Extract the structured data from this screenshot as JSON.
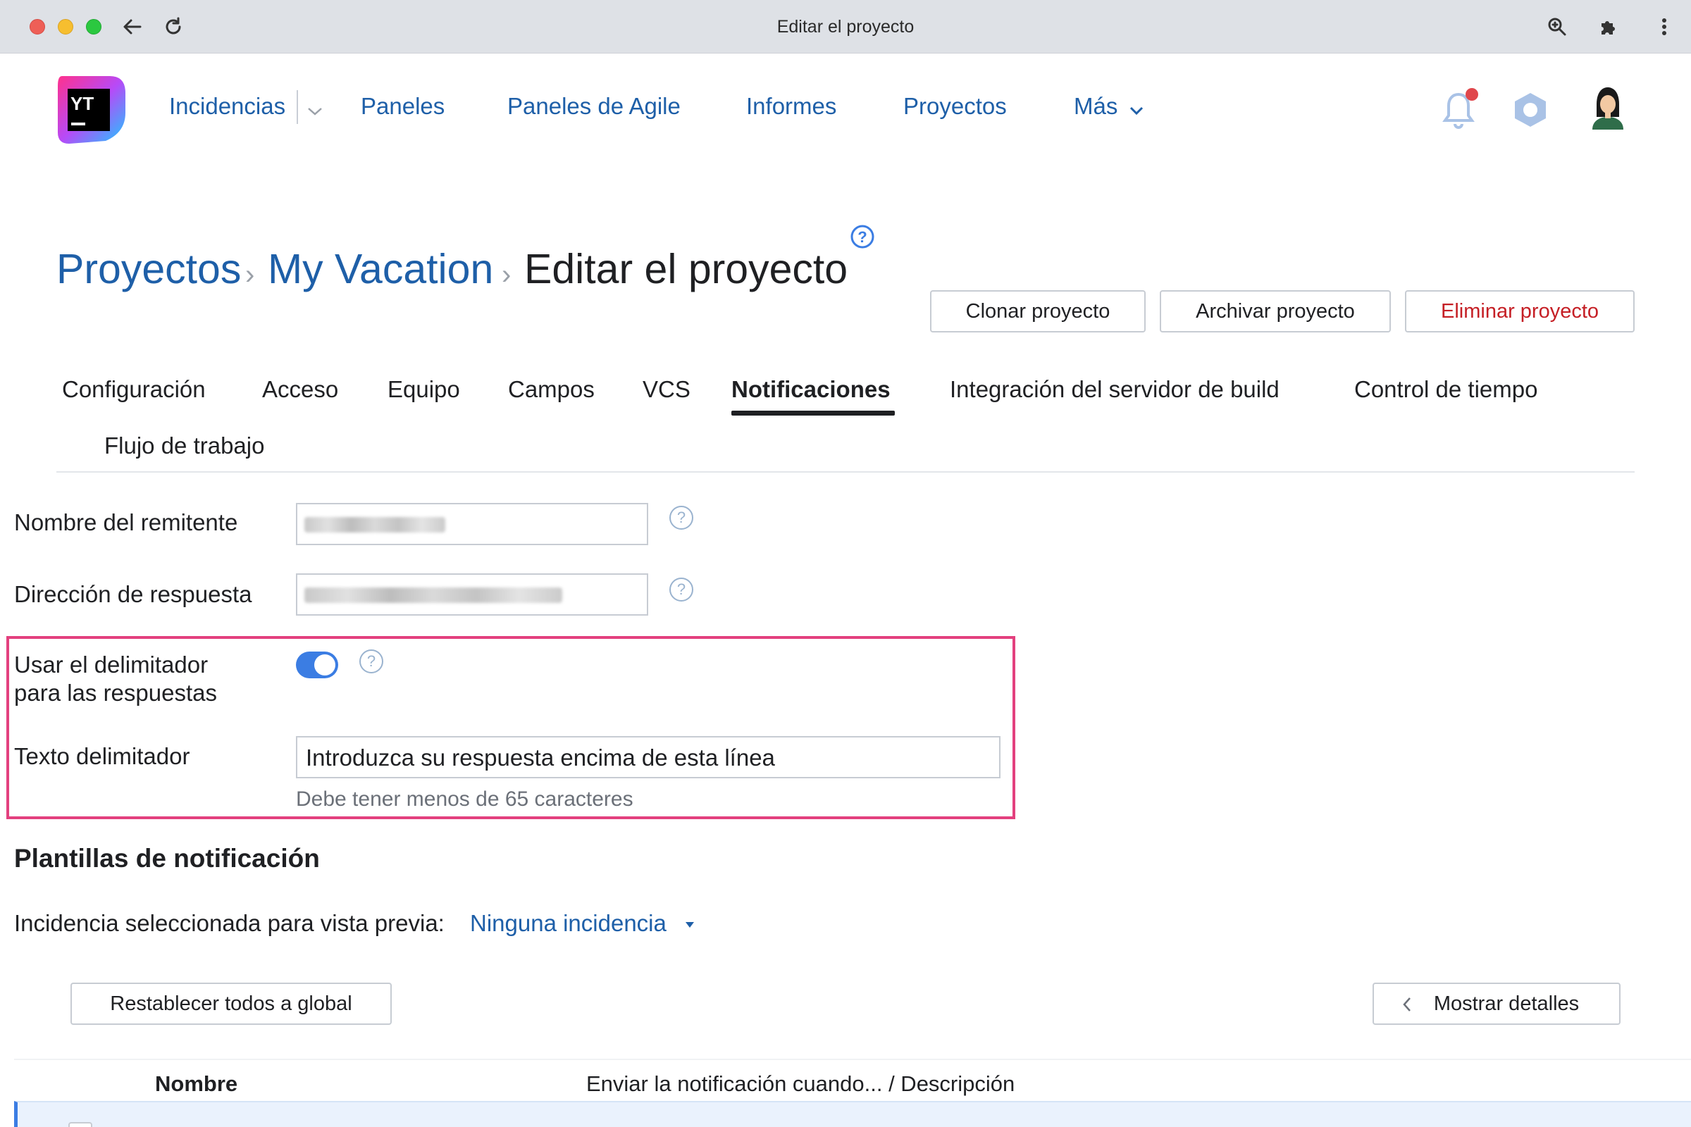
{
  "browser": {
    "title": "Editar el proyecto"
  },
  "nav": {
    "items": [
      "Incidencias",
      "Paneles",
      "Paneles de Agile",
      "Informes",
      "Proyectos",
      "Más"
    ]
  },
  "breadcrumb": {
    "items": [
      "Proyectos",
      "My Vacation"
    ],
    "current": "Editar el proyecto"
  },
  "actions": {
    "clone": "Clonar proyecto",
    "archive": "Archivar proyecto",
    "delete": "Eliminar proyecto"
  },
  "tabs": {
    "items": [
      "Configuración",
      "Acceso",
      "Equipo",
      "Campos",
      "VCS",
      "Notificaciones",
      "Integración del servidor de build",
      "Control de tiempo",
      "Flujo de trabajo"
    ],
    "active": "Notificaciones"
  },
  "form": {
    "sender_name_label": "Nombre del remitente",
    "reply_address_label": "Dirección de respuesta",
    "delimiter_toggle_label_line1": "Usar el delimitador",
    "delimiter_toggle_label_line2": "para las respuestas",
    "delimiter_toggle_on": true,
    "delimiter_text_label": "Texto delimitador",
    "delimiter_text_value": "Introduzca su respuesta encima de esta línea",
    "delimiter_hint": "Debe tener menos de 65 caracteres"
  },
  "templates": {
    "title": "Plantillas de notificación",
    "preview_label": "Incidencia seleccionada para vista previa:",
    "preview_value": "Ninguna incidencia",
    "reset_button": "Restablecer todos a global",
    "details_button": "Mostrar detalles",
    "columns": [
      "Nombre",
      "Enviar la notificación cuando... / Descripción"
    ]
  },
  "colors": {
    "link": "#1e5fa8",
    "highlight": "#e3407e",
    "toggle": "#3b7de3",
    "danger": "#c51f25"
  }
}
